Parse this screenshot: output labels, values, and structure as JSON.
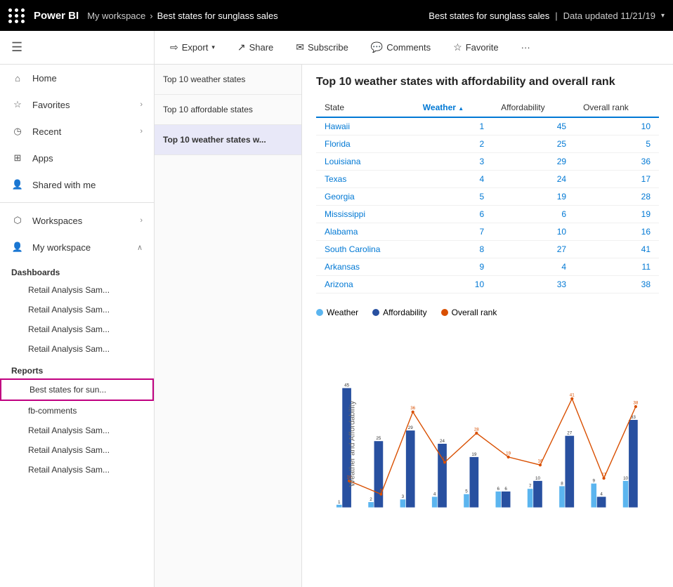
{
  "topbar": {
    "brand": "Power BI",
    "breadcrumb": [
      "My workspace",
      "Best states for sunglass sales"
    ],
    "report_title": "Best states for sunglass sales",
    "data_updated": "Data updated 11/21/19"
  },
  "actions": {
    "export": "Export",
    "share": "Share",
    "subscribe": "Subscribe",
    "comments": "Comments",
    "favorite": "Favorite"
  },
  "left_nav": {
    "home": "Home",
    "favorites": "Favorites",
    "recent": "Recent",
    "apps": "Apps",
    "shared_with_me": "Shared with me",
    "workspaces": "Workspaces",
    "my_workspace": "My workspace",
    "dashboards_header": "Dashboards",
    "dashboard_items": [
      "Retail Analysis Sam...",
      "Retail Analysis Sam...",
      "Retail Analysis Sam...",
      "Retail Analysis Sam..."
    ],
    "reports_header": "Reports",
    "report_items": [
      "Best states for sun...",
      "fb-comments",
      "Retail Analysis Sam...",
      "Retail Analysis Sam...",
      "Retail Analysis Sam..."
    ]
  },
  "pages": [
    {
      "label": "Top 10 weather states",
      "active": false
    },
    {
      "label": "Top 10 affordable states",
      "active": false
    },
    {
      "label": "Top 10 weather states w...",
      "active": true
    }
  ],
  "viz": {
    "title": "Top 10 weather states with affordability and overall rank",
    "table": {
      "headers": [
        "State",
        "Weather",
        "Affordability",
        "Overall rank"
      ],
      "sorted_col": "Weather",
      "rows": [
        [
          "Hawaii",
          "1",
          "45",
          "10"
        ],
        [
          "Florida",
          "2",
          "25",
          "5"
        ],
        [
          "Louisiana",
          "3",
          "29",
          "36"
        ],
        [
          "Texas",
          "4",
          "24",
          "17"
        ],
        [
          "Georgia",
          "5",
          "19",
          "28"
        ],
        [
          "Mississippi",
          "6",
          "6",
          "19"
        ],
        [
          "Alabama",
          "7",
          "10",
          "16"
        ],
        [
          "South Carolina",
          "8",
          "27",
          "41"
        ],
        [
          "Arkansas",
          "9",
          "4",
          "11"
        ],
        [
          "Arizona",
          "10",
          "33",
          "38"
        ]
      ]
    },
    "legend": [
      {
        "label": "Weather",
        "color": "#5bb5ef"
      },
      {
        "label": "Affordability",
        "color": "#2850a0"
      },
      {
        "label": "Overall rank",
        "color": "#d94f00"
      }
    ],
    "chart_y_label": "Weather and Affordability",
    "chart_data": [
      {
        "state": "Hawaii",
        "weather": 1,
        "affordability": 45,
        "overall": 10
      },
      {
        "state": "Florida",
        "weather": 2,
        "affordability": 25,
        "overall": 5
      },
      {
        "state": "Louisiana",
        "weather": 3,
        "affordability": 29,
        "overall": 36
      },
      {
        "state": "Texas",
        "weather": 4,
        "affordability": 24,
        "overall": 17
      },
      {
        "state": "Georgia",
        "weather": 5,
        "affordability": 19,
        "overall": 28
      },
      {
        "state": "Mississippi",
        "weather": 6,
        "affordability": 6,
        "overall": 19
      },
      {
        "state": "Alabama",
        "weather": 7,
        "affordability": 10,
        "overall": 16
      },
      {
        "state": "South Carolina",
        "weather": 8,
        "affordability": 27,
        "overall": 41
      },
      {
        "state": "Arkansas",
        "weather": 9,
        "affordability": 4,
        "overall": 11
      },
      {
        "state": "Arizona",
        "weather": 10,
        "affordability": 33,
        "overall": 38
      }
    ]
  }
}
